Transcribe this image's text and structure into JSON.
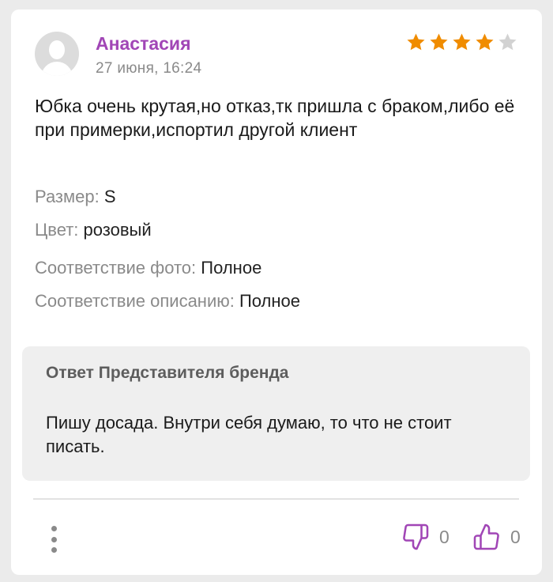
{
  "review": {
    "author": "Анастасия",
    "date": "27 июня, 16:24",
    "rating": 4,
    "rating_max": 5,
    "text": "Юбка очень крутая,но отказ,тк пришла с браком,либо её при примерки,испортил другой клиент",
    "attributes": {
      "size_label": "Размер:",
      "size_value": "S",
      "color_label": "Цвет:",
      "color_value": "розовый",
      "photo_match_label": "Соответствие фото:",
      "photo_match_value": "Полное",
      "description_match_label": "Соответствие описанию:",
      "description_match_value": "Полное"
    }
  },
  "reply": {
    "title": "Ответ Представителя бренда",
    "text": "Пишу досада. Внутри себя думаю, то что не стоит писать."
  },
  "footer": {
    "more_icon": "more-vertical-icon",
    "dislike_icon": "thumbs-down-icon",
    "dislike_count": "0",
    "like_icon": "thumbs-up-icon",
    "like_count": "0"
  },
  "colors": {
    "accent": "#a146b6",
    "star_filled": "#f08c00",
    "star_empty": "#d2d2d2",
    "muted": "#8a8a8a",
    "reply_bg": "#efefef"
  }
}
